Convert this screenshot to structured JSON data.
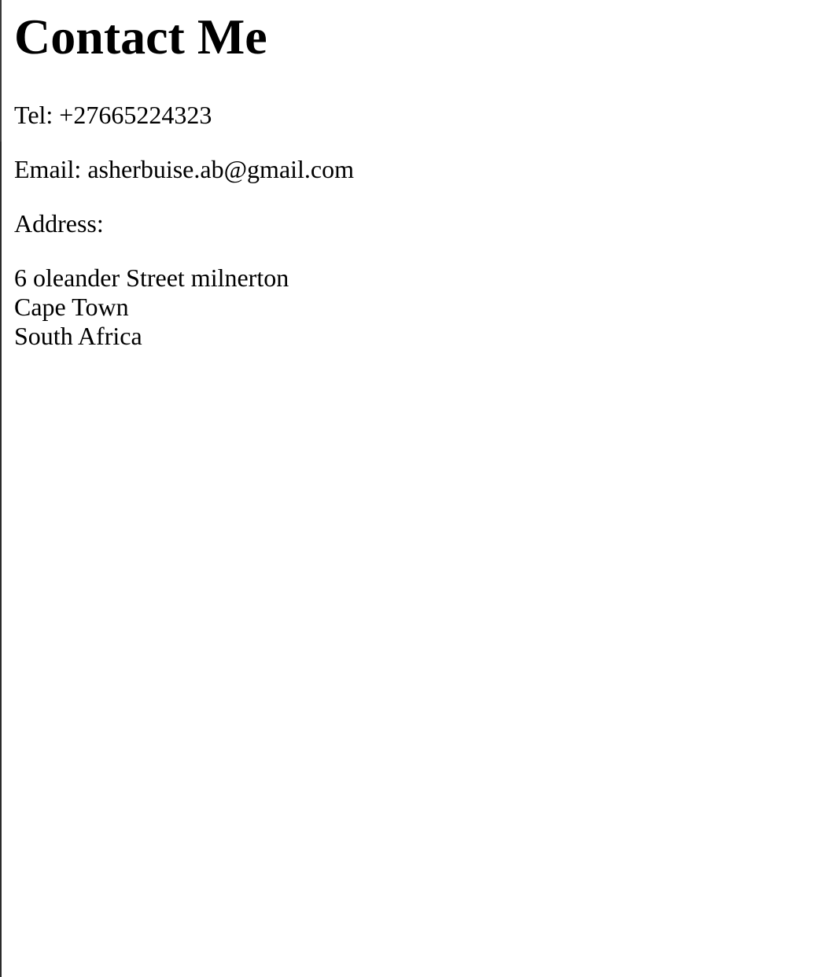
{
  "page": {
    "title": "Contact Me"
  },
  "contact": {
    "tel": "Tel: +27665224323",
    "email": "Email: asherbuise.ab@gmail.com",
    "address_label": "Address:",
    "address_lines": [
      "6 oleander Street milnerton",
      "Cape Town",
      "South Africa"
    ]
  }
}
